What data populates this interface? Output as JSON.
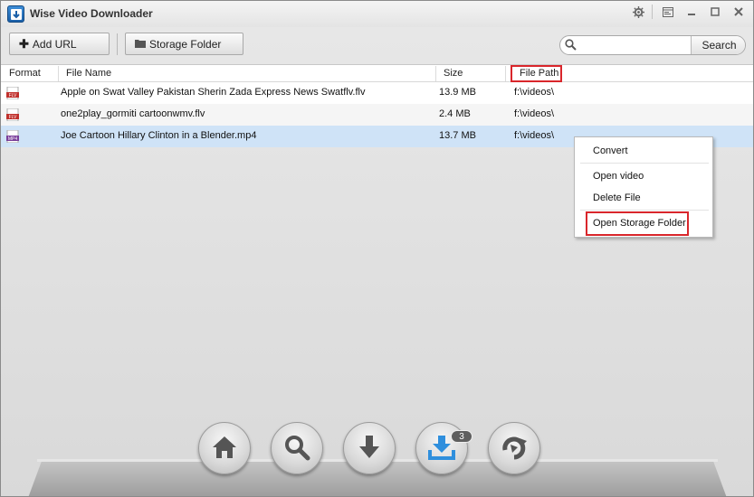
{
  "app": {
    "title": "Wise Video Downloader"
  },
  "window_controls": {
    "settings_icon": "gear-icon",
    "skin_icon": "skin-icon",
    "minimize_icon": "minimize-icon",
    "maximize_icon": "maximize-icon",
    "close_icon": "close-icon"
  },
  "toolbar": {
    "add_url_label": "Add URL",
    "storage_folder_label": "Storage Folder",
    "search_placeholder": "",
    "search_button_label": "Search"
  },
  "columns": [
    "Format",
    "File Name",
    "Size",
    "File Path"
  ],
  "rows": [
    {
      "format": "FLV",
      "name": "Apple on Swat Valley Pakistan Sherin Zada Express News Swatflv.flv",
      "size": "13.9 MB",
      "path": "f:\\videos\\"
    },
    {
      "format": "FLV",
      "name": "one2play_gormiti cartoonwmv.flv",
      "size": "2.4 MB",
      "path": "f:\\videos\\"
    },
    {
      "format": "MP4",
      "name": "Joe Cartoon  Hillary Clinton in a Blender.mp4",
      "size": "13.7 MB",
      "path": "f:\\videos\\"
    }
  ],
  "context_menu": {
    "items": [
      "Convert",
      "Open video",
      "Delete File",
      "Open Storage Folder"
    ]
  },
  "dock": {
    "download_badge": "3",
    "buttons": [
      "home-icon",
      "search-icon",
      "download-icon",
      "downloaded-icon",
      "refresh-icon"
    ]
  },
  "colors": {
    "highlight": "#d9262b",
    "selected_row": "#cfe3f7",
    "accent": "#3d8ed8"
  }
}
